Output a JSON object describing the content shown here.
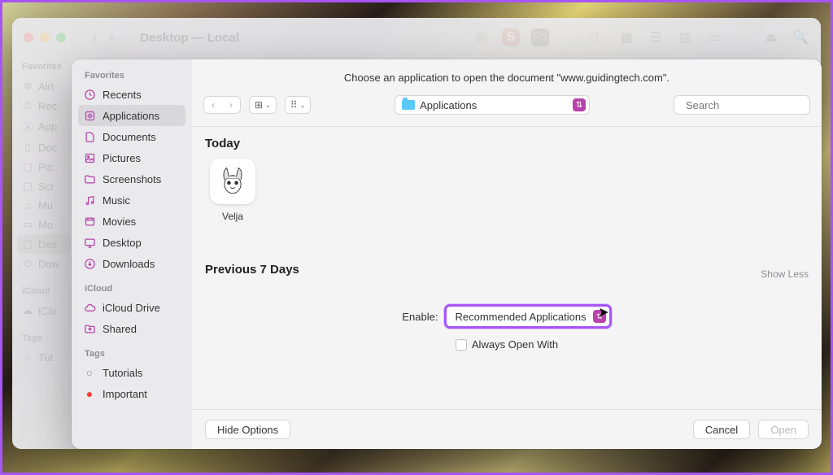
{
  "finder": {
    "title": "Desktop — Local",
    "sidebar": {
      "favorites_head": "Favorites",
      "items": [
        "Airt",
        "Rec",
        "App",
        "Doc",
        "Pic",
        "Scr",
        "Mu",
        "Mo",
        "Des",
        "Dow"
      ],
      "icloud_head": "iCloud",
      "icloud_items": [
        "iClo"
      ],
      "tags_head": "Tags",
      "tags_items": [
        "Tut"
      ]
    }
  },
  "dialog": {
    "prompt": "Choose an application to open the document \"www.guidingtech.com\".",
    "path": "Applications",
    "search_placeholder": "Search",
    "sidebar": {
      "favorites_head": "Favorites",
      "favorites": [
        {
          "label": "Recents",
          "icon": "clock"
        },
        {
          "label": "Applications",
          "icon": "apps",
          "selected": true
        },
        {
          "label": "Documents",
          "icon": "doc"
        },
        {
          "label": "Pictures",
          "icon": "pic"
        },
        {
          "label": "Screenshots",
          "icon": "folder"
        },
        {
          "label": "Music",
          "icon": "music"
        },
        {
          "label": "Movies",
          "icon": "movie"
        },
        {
          "label": "Desktop",
          "icon": "desktop"
        },
        {
          "label": "Downloads",
          "icon": "download"
        }
      ],
      "icloud_head": "iCloud",
      "icloud": [
        {
          "label": "iCloud Drive",
          "icon": "cloud"
        },
        {
          "label": "Shared",
          "icon": "shared"
        }
      ],
      "tags_head": "Tags",
      "tags": [
        {
          "label": "Tutorials",
          "icon": "dot-gray"
        },
        {
          "label": "Important",
          "icon": "dot-red"
        }
      ]
    },
    "sections": {
      "today": "Today",
      "today_apps": [
        {
          "name": "Velja"
        }
      ],
      "prev7": "Previous 7 Days",
      "show_less": "Show Less"
    },
    "enable": {
      "label": "Enable:",
      "value": "Recommended Applications",
      "always_label": "Always Open With"
    },
    "footer": {
      "hide_options": "Hide Options",
      "cancel": "Cancel",
      "open": "Open"
    }
  }
}
